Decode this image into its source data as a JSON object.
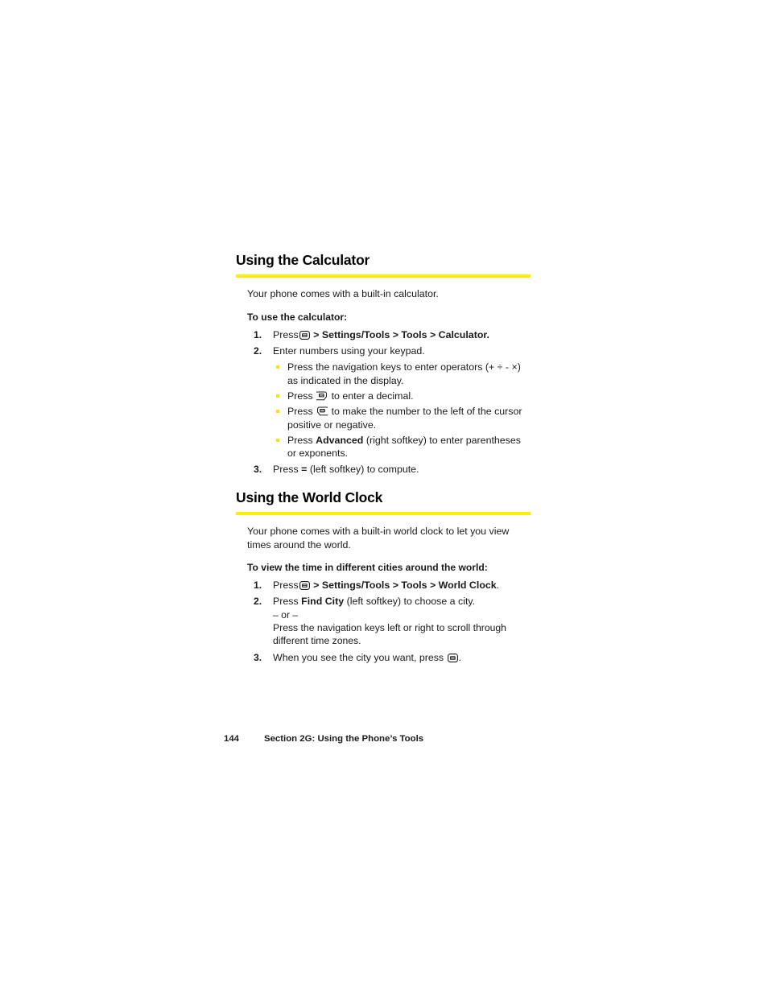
{
  "page": {
    "accent_color": "#ffed00",
    "bullet_color": "#ffe000",
    "text_color": "#1a1a1a"
  },
  "sections": [
    {
      "id": "calculator",
      "heading": "Using the Calculator",
      "intro": "Your phone comes with a built-in calculator.",
      "lead_in": "To use the calculator:",
      "steps": [
        {
          "num": "1.",
          "press_label": "Press",
          "key_icon": "ok-key-icon",
          "path": "> Settings/Tools > Tools > Calculator.",
          "trailing": ""
        },
        {
          "num": "2.",
          "text": "Enter numbers using your keypad.",
          "subs": [
            {
              "pre": "Press the navigation keys to enter operators (+ ÷ - ×) as indicated in the display.",
              "key_icon": "",
              "bold": "",
              "post": ""
            },
            {
              "pre": "Press",
              "key_icon": "decimal-key-icon",
              "bold": "",
              "post": "to enter a decimal."
            },
            {
              "pre": "Press",
              "key_icon": "sign-key-icon",
              "bold": "",
              "post": "to make the number to the left of the cursor positive or negative."
            },
            {
              "pre": "Press",
              "key_icon": "",
              "bold": "Advanced",
              "post": "(right softkey) to enter parentheses or exponents."
            }
          ]
        },
        {
          "num": "3.",
          "pre": "Press",
          "bold": "=",
          "post": "(left softkey) to compute."
        }
      ]
    },
    {
      "id": "worldclock",
      "heading": "Using the World Clock",
      "intro": "Your phone comes with a built-in world clock to let you view times around the world.",
      "lead_in": "To view the time in different cities around the world:",
      "steps": [
        {
          "num": "1.",
          "press_label": "Press",
          "key_icon": "ok-key-icon",
          "path": "> Settings/Tools > Tools > World Clock",
          "trailing": "."
        },
        {
          "num": "2.",
          "pre": "Press",
          "bold": "Find City",
          "post": "(left softkey) to choose a city.",
          "or_text": "– or –",
          "alt": "Press the navigation keys left or right to scroll through different time zones."
        },
        {
          "num": "3.",
          "pre": "When you see the city you want, press",
          "key_icon": "ok-key-icon",
          "post": "."
        }
      ]
    }
  ],
  "footer": {
    "page_number": "144",
    "section_label": "Section 2G: Using the Phone’s Tools"
  }
}
